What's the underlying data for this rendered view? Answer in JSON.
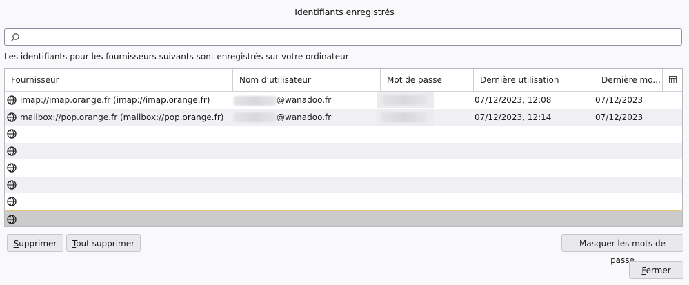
{
  "window": {
    "title": "Identifiants enregistrés"
  },
  "search": {
    "placeholder": "",
    "value": ""
  },
  "info_text": "Les identifiants pour les fournisseurs suivants sont enregistrés sur votre ordinateur",
  "table": {
    "columns": [
      "Fournisseur",
      "Nom d’utilisateur",
      "Mot de passe",
      "Dernière utilisation",
      "Dernière mo..."
    ],
    "rows": [
      {
        "provider": "imap://imap.orange.fr (imap://imap.orange.fr)",
        "username_visible": "@wanadoo.fr",
        "last_used": "07/12/2023, 12:08",
        "last_modified": "07/12/2023"
      },
      {
        "provider": "mailbox://pop.orange.fr (mailbox://pop.orange.fr)",
        "username_visible": "@wanadoo.fr",
        "last_used": "07/12/2023, 12:14",
        "last_modified": "07/12/2023"
      },
      {
        "provider": "",
        "username_visible": "",
        "last_used": "",
        "last_modified": ""
      },
      {
        "provider": "",
        "username_visible": "",
        "last_used": "",
        "last_modified": ""
      },
      {
        "provider": "",
        "username_visible": "",
        "last_used": "",
        "last_modified": ""
      },
      {
        "provider": "",
        "username_visible": "",
        "last_used": "",
        "last_modified": ""
      },
      {
        "provider": "",
        "username_visible": "",
        "last_used": "",
        "last_modified": ""
      },
      {
        "provider": "",
        "username_visible": "",
        "last_used": "",
        "last_modified": ""
      }
    ]
  },
  "buttons": {
    "remove": {
      "first": "S",
      "rest": "upprimer"
    },
    "remove_all": {
      "first": "T",
      "rest": "out supprimer"
    },
    "hide_passwords": "Masquer les mots de passe",
    "close": {
      "first": "F",
      "rest": "ermer"
    }
  },
  "icons": {
    "search": "search-icon",
    "globe": "globe-icon",
    "column_picker": "column-picker-icon"
  },
  "colors": {
    "selected_row": "#cbcbcb",
    "alt_row": "#f0f0f4",
    "button_bg": "#e9e9ed"
  }
}
